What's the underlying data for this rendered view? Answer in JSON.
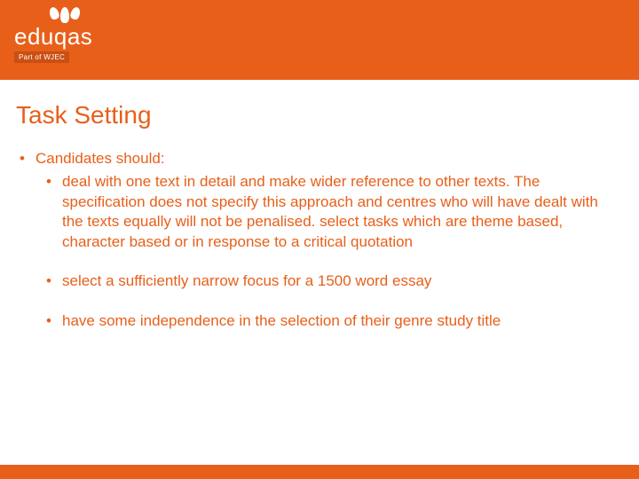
{
  "brand": {
    "name": "eduqas",
    "tagline": "Part of WJEC"
  },
  "slide": {
    "title": "Task Setting",
    "lead": "Candidates should:",
    "bullets": [
      "deal with one text in detail and make wider reference to other texts. The specification does not specify this approach and centres who will have dealt with the texts equally will not be penalised. select tasks which are theme based, character based or in response to a critical quotation",
      "select a sufficiently narrow focus for a 1500 word essay",
      "have some independence in the selection of their genre study title"
    ]
  }
}
